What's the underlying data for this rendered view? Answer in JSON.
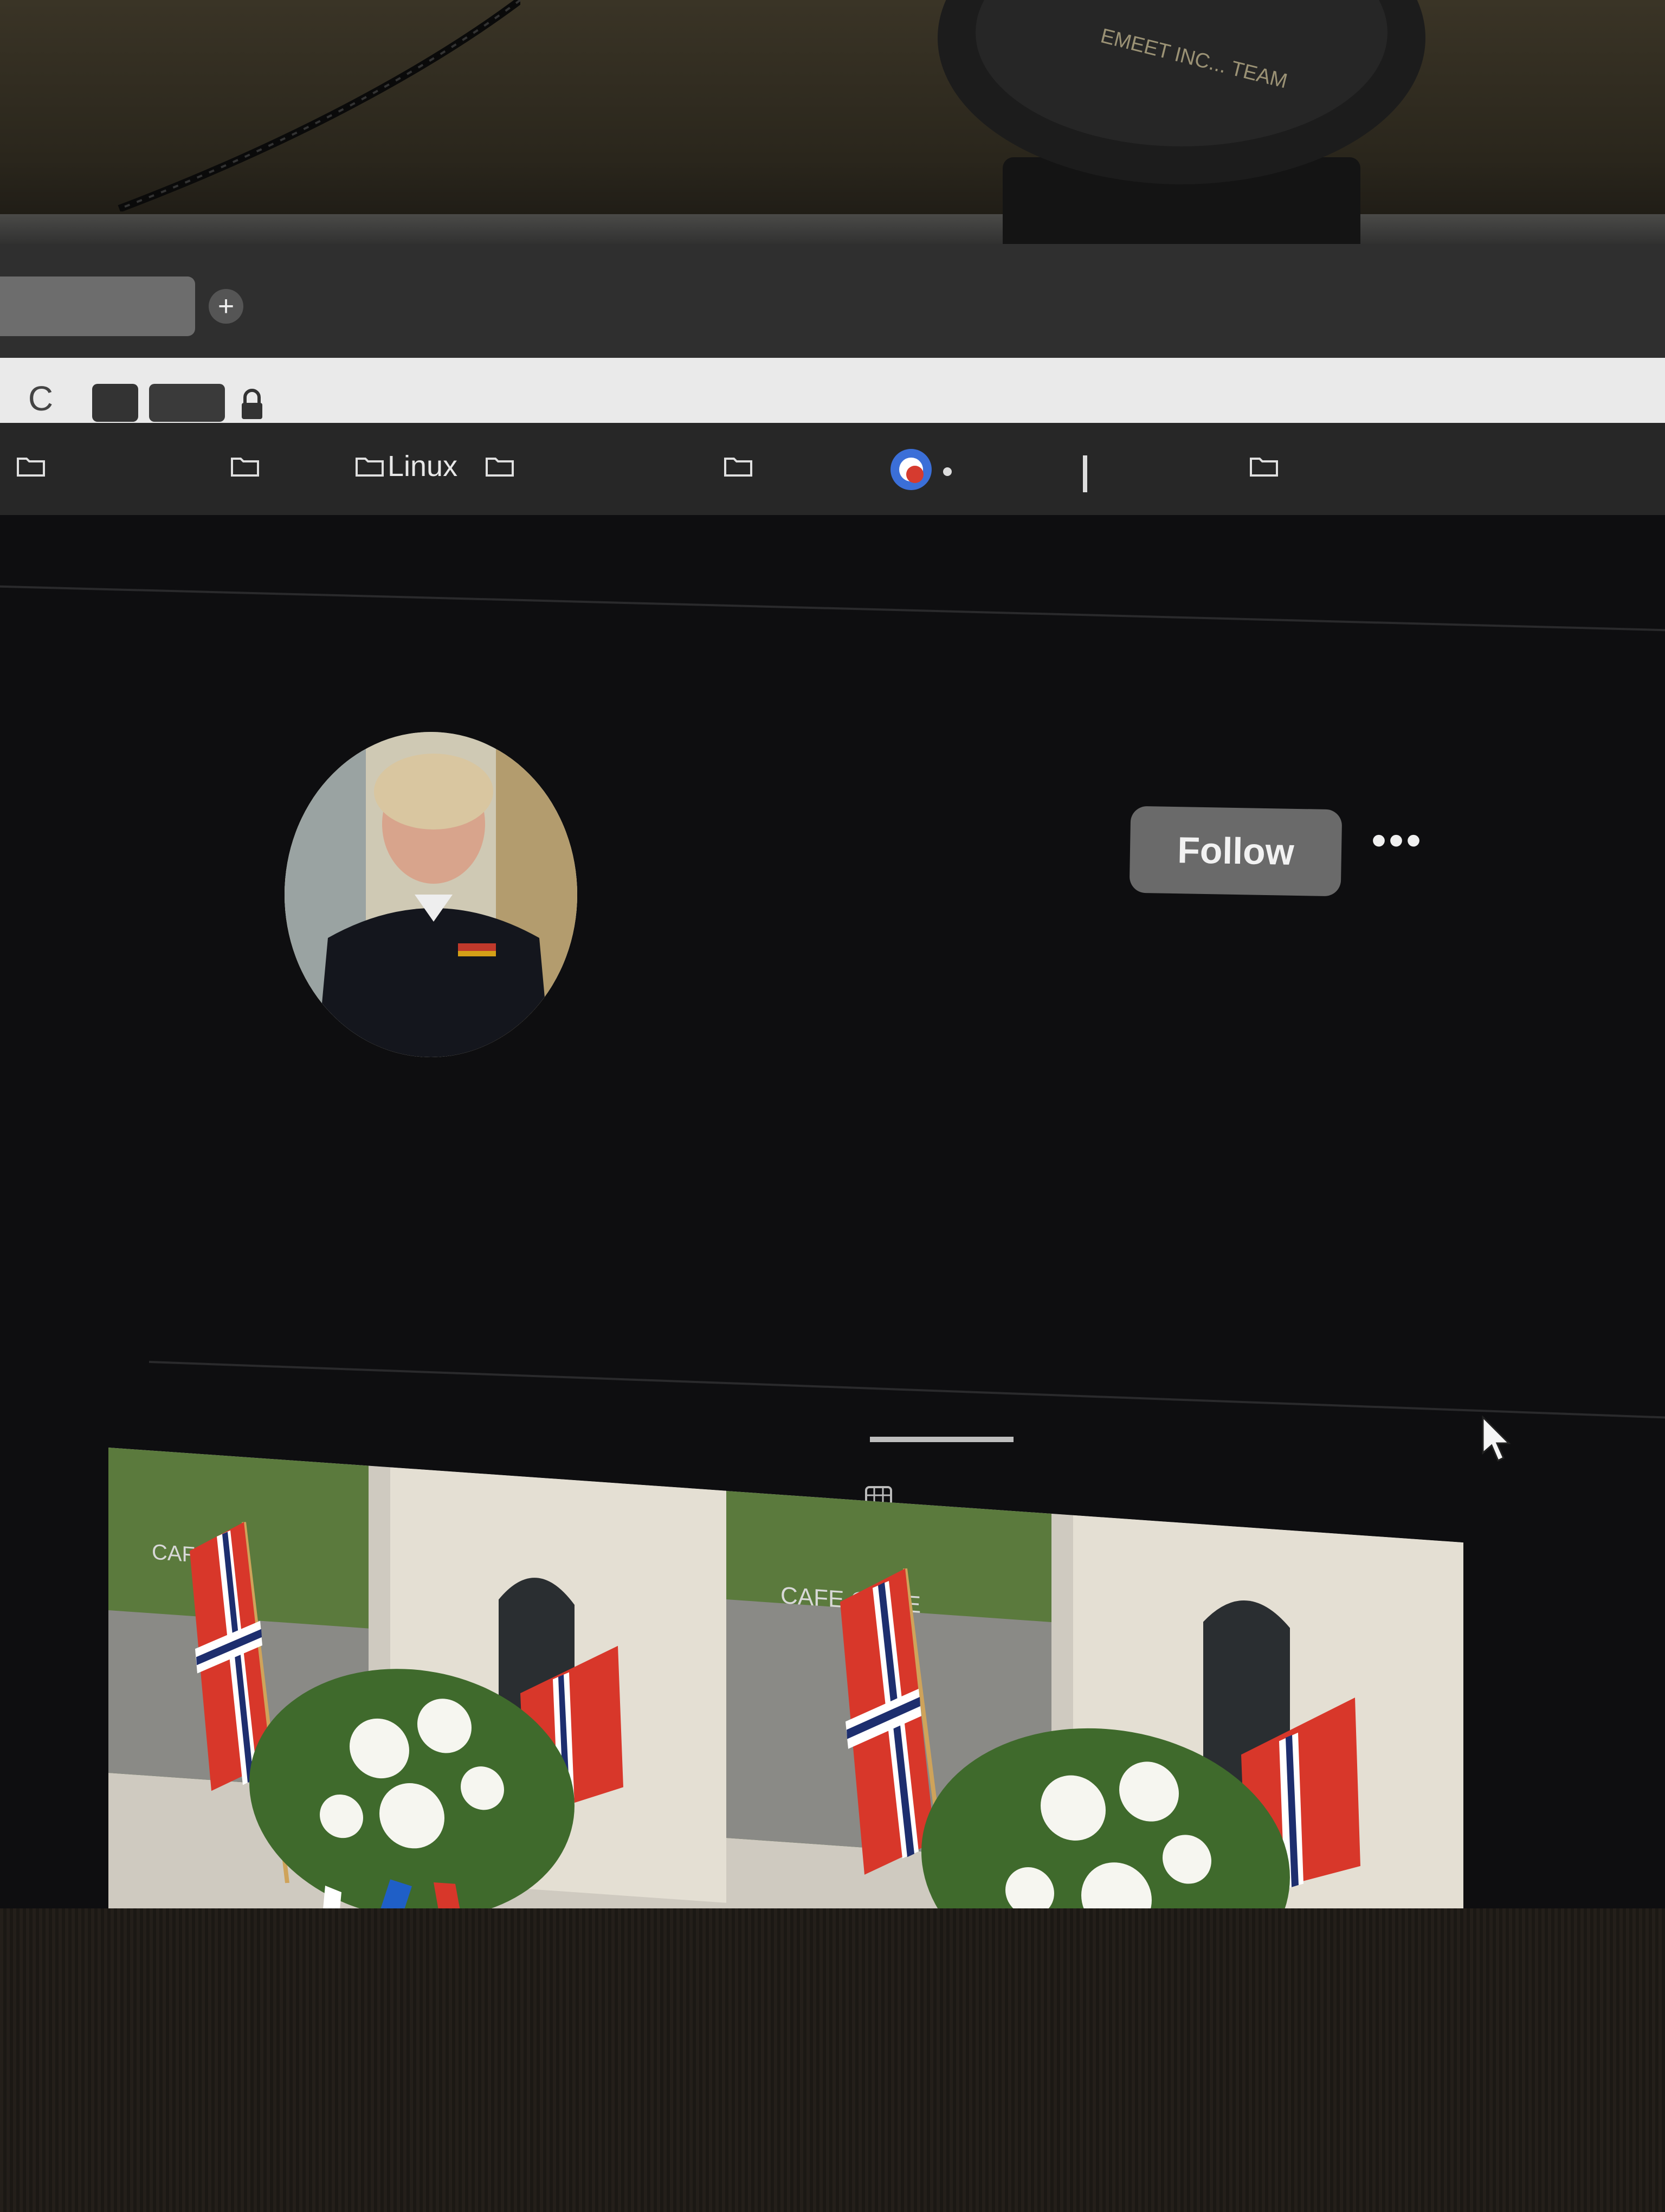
{
  "webcam": {
    "brand_text": "EMEET INC... TEAM"
  },
  "browser": {
    "new_tab_symbol": "+",
    "reload_symbol": "C",
    "bookmarks": [
      {
        "label": ""
      },
      {
        "label": ""
      },
      {
        "label": "Linux"
      },
      {
        "label": ""
      },
      {
        "label": ""
      },
      {
        "label": ""
      }
    ]
  },
  "profile": {
    "follow_label": "Follow",
    "more_label": "•••"
  },
  "posts": [
    {
      "photo_sign_text": "CAFE"
    },
    {
      "photo_sign_text": "CAFE ORGE"
    }
  ],
  "colors": {
    "norway_red": "#d8372a",
    "norway_blue": "#1d2e6e",
    "ribbon_blue": "#1f5fc7"
  }
}
